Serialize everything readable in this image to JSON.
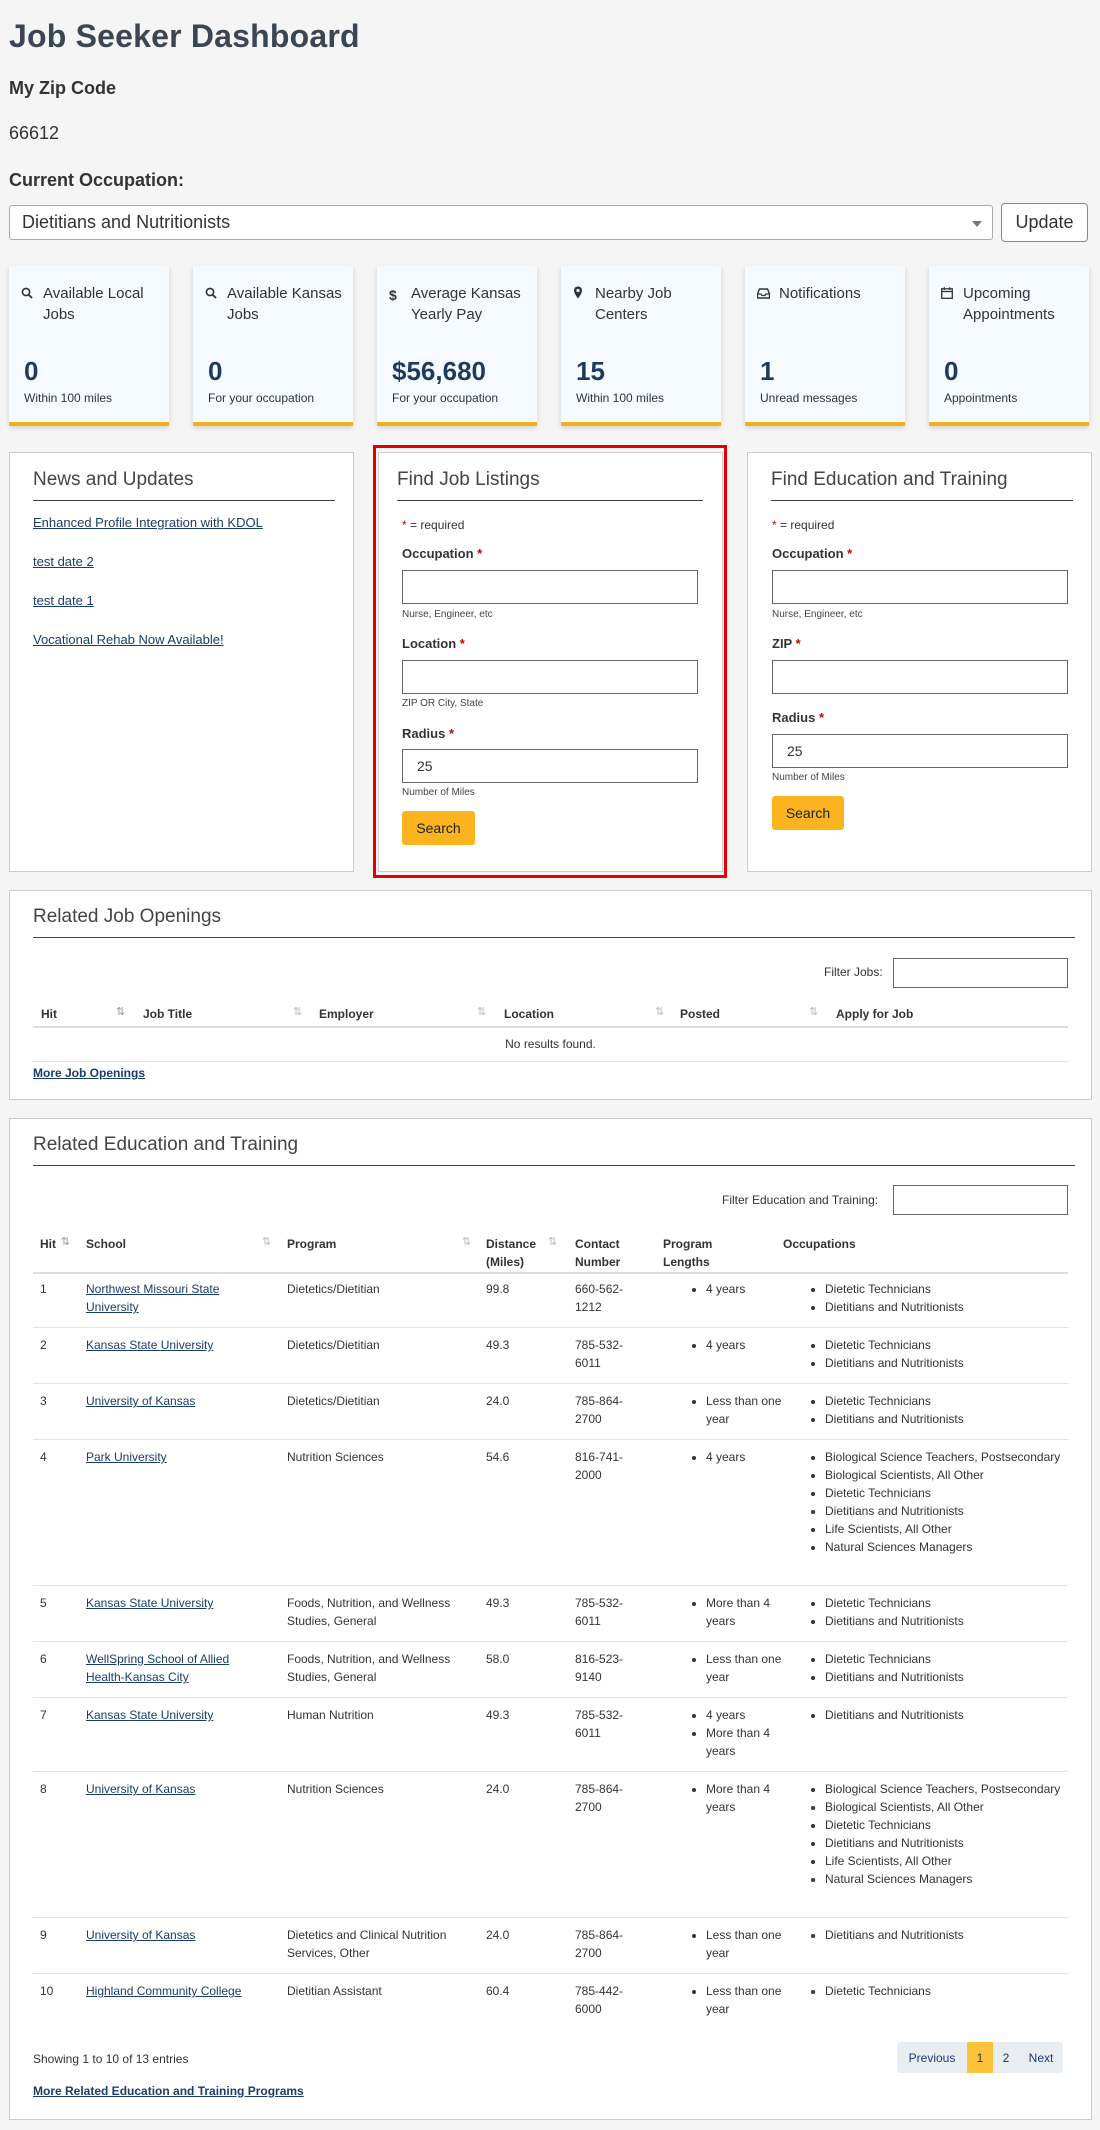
{
  "page": {
    "title": "Job Seeker Dashboard"
  },
  "zip": {
    "label": "My Zip Code",
    "value": "66612"
  },
  "occupation": {
    "label": "Current Occupation:",
    "selected": "Dietitians and Nutritionists",
    "update_label": "Update"
  },
  "stats": [
    {
      "icon": "search-icon",
      "label": "Available Local Jobs",
      "value": "0",
      "sub": "Within 100 miles"
    },
    {
      "icon": "search-icon",
      "label": "Available Kansas Jobs",
      "value": "0",
      "sub": "For your occupation"
    },
    {
      "icon": "dollar-icon",
      "label": "Average Kansas Yearly Pay",
      "value": "$56,680",
      "sub": "For your occupation"
    },
    {
      "icon": "map-pin-icon",
      "label": "Nearby Job Centers",
      "value": "15",
      "sub": "Within 100 miles"
    },
    {
      "icon": "inbox-icon",
      "label": "Notifications",
      "value": "1",
      "sub": "Unread messages"
    },
    {
      "icon": "calendar-icon",
      "label": "Upcoming Appointments",
      "value": "0",
      "sub": "Appointments"
    }
  ],
  "news": {
    "title": "News and Updates",
    "items": [
      "Enhanced Profile Integration with KDOL",
      "test date 2",
      "test date 1",
      "Vocational Rehab Now Available!"
    ]
  },
  "find_jobs": {
    "title": "Find Job Listings",
    "required_note": "= required",
    "occupation_label": "Occupation",
    "occupation_help": "Nurse, Engineer, etc",
    "location_label": "Location",
    "location_help": "ZIP OR City, State",
    "radius_label": "Radius",
    "radius_value": "25",
    "radius_help": "Number of Miles",
    "search_label": "Search"
  },
  "find_education": {
    "title": "Find Education and Training",
    "required_note": "= required",
    "occupation_label": "Occupation",
    "occupation_help": "Nurse, Engineer, etc",
    "zip_label": "ZIP",
    "radius_label": "Radius",
    "radius_value": "25",
    "radius_help": "Number of Miles",
    "search_label": "Search"
  },
  "job_openings": {
    "title": "Related Job Openings",
    "filter_label": "Filter Jobs:",
    "columns": [
      "Hit",
      "Job Title",
      "Employer",
      "Location",
      "Posted",
      "Apply for Job"
    ],
    "empty_message": "No results found.",
    "more_link": "More Job Openings"
  },
  "education": {
    "title": "Related Education and Training",
    "filter_label": "Filter Education and Training:",
    "columns": {
      "hit": "Hit",
      "school": "School",
      "program": "Program",
      "distance_line1": "Distance",
      "distance_line2": "(Miles)",
      "contact_line1": "Contact",
      "contact_line2": "Number",
      "lengths_line1": "Program",
      "lengths_line2": "Lengths",
      "occupations": "Occupations"
    },
    "rows": [
      {
        "hit": "1",
        "school": "Northwest Missouri State University",
        "program": "Dietetics/Dietitian",
        "distance": "99.8",
        "contact": "660-562-1212",
        "lengths": [
          "4 years"
        ],
        "occupations": [
          "Dietetic Technicians",
          "Dietitians and Nutritionists"
        ]
      },
      {
        "hit": "2",
        "school": "Kansas State University",
        "program": "Dietetics/Dietitian",
        "distance": "49.3",
        "contact": "785-532-6011",
        "lengths": [
          "4 years"
        ],
        "occupations": [
          "Dietetic Technicians",
          "Dietitians and Nutritionists"
        ]
      },
      {
        "hit": "3",
        "school": "University of Kansas",
        "program": "Dietetics/Dietitian",
        "distance": "24.0",
        "contact": "785-864-2700",
        "lengths": [
          "Less than one year"
        ],
        "occupations": [
          "Dietetic Technicians",
          "Dietitians and Nutritionists"
        ]
      },
      {
        "hit": "4",
        "school": "Park University",
        "program": "Nutrition Sciences",
        "distance": "54.6",
        "contact": "816-741-2000",
        "lengths": [
          "4 years"
        ],
        "occupations": [
          "Biological Science Teachers, Postsecondary",
          "Biological Scientists, All Other",
          "Dietetic Technicians",
          "Dietitians and Nutritionists",
          "Life Scientists, All Other",
          "Natural Sciences Managers"
        ]
      },
      {
        "hit": "5",
        "school": "Kansas State University",
        "program": "Foods, Nutrition, and Wellness Studies, General",
        "distance": "49.3",
        "contact": "785-532-6011",
        "lengths": [
          "More than 4 years"
        ],
        "occupations": [
          "Dietetic Technicians",
          "Dietitians and Nutritionists"
        ]
      },
      {
        "hit": "6",
        "school": "WellSpring School of Allied Health-Kansas City",
        "program": "Foods, Nutrition, and Wellness Studies, General",
        "distance": "58.0",
        "contact": "816-523-9140",
        "lengths": [
          "Less than one year"
        ],
        "occupations": [
          "Dietetic Technicians",
          "Dietitians and Nutritionists"
        ]
      },
      {
        "hit": "7",
        "school": "Kansas State University",
        "program": "Human Nutrition",
        "distance": "49.3",
        "contact": "785-532-6011",
        "lengths": [
          "4 years",
          "More than 4 years"
        ],
        "occupations": [
          "Dietitians and Nutritionists"
        ]
      },
      {
        "hit": "8",
        "school": "University of Kansas",
        "program": "Nutrition Sciences",
        "distance": "24.0",
        "contact": "785-864-2700",
        "lengths": [
          "More than 4 years"
        ],
        "occupations": [
          "Biological Science Teachers, Postsecondary",
          "Biological Scientists, All Other",
          "Dietetic Technicians",
          "Dietitians and Nutritionists",
          "Life Scientists, All Other",
          "Natural Sciences Managers"
        ]
      },
      {
        "hit": "9",
        "school": "University of Kansas",
        "program": "Dietetics and Clinical Nutrition Services, Other",
        "distance": "24.0",
        "contact": "785-864-2700",
        "lengths": [
          "Less than one year"
        ],
        "occupations": [
          "Dietitians and Nutritionists"
        ]
      },
      {
        "hit": "10",
        "school": "Highland Community College",
        "program": "Dietitian Assistant",
        "distance": "60.4",
        "contact": "785-442-6000",
        "lengths": [
          "Less than one year"
        ],
        "occupations": [
          "Dietetic Technicians"
        ]
      }
    ],
    "showing": "Showing 1 to 10 of 13 entries",
    "pagination": {
      "previous": "Previous",
      "pages": [
        "1",
        "2"
      ],
      "next": "Next",
      "current": "1"
    },
    "more_link": "More Related Education and Training Programs"
  },
  "colors": {
    "accent": "#fbb41f",
    "highlight": "#e30000",
    "link": "#1a3d6b",
    "stat_value": "#1f3a5f"
  }
}
